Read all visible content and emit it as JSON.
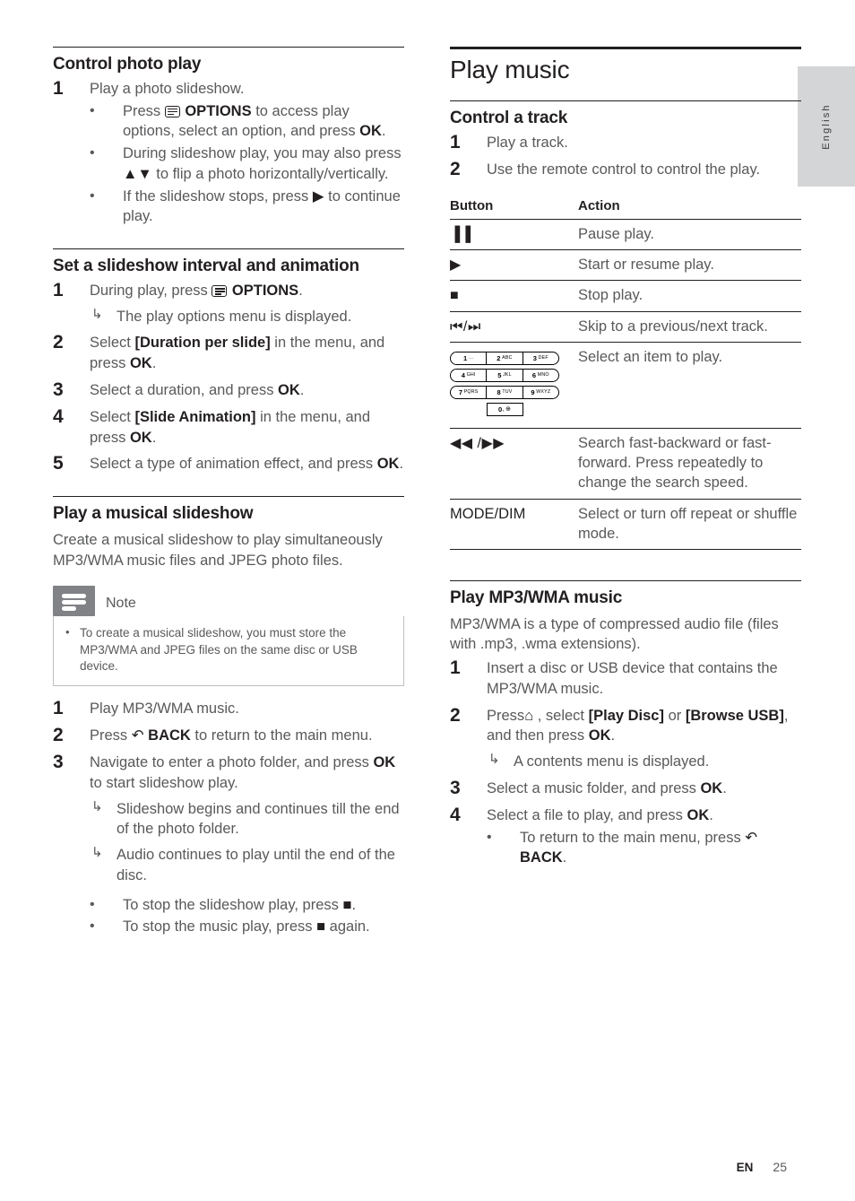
{
  "language_tab": {
    "label": "English"
  },
  "footer": {
    "locale": "EN",
    "page_number": "25"
  },
  "left_column": {
    "sections": [
      {
        "heading": "Control photo play",
        "steps": [
          {
            "num": "1",
            "text": "Play a photo slideshow.",
            "bullets": [
              {
                "pre": "Press ",
                "icon": "options-icon",
                "bold1": " OPTIONS",
                "mid": " to access play options, select an option, and press ",
                "bold2": "OK",
                "post": "."
              },
              {
                "pre": "During slideshow play, you may also press ",
                "glyph": "▲▼",
                "mid": " to flip a photo horizontally/vertically.",
                "bold2": "",
                "post": ""
              },
              {
                "pre": "If the slideshow stops, press ",
                "glyph": "▶",
                "mid": " to continue play.",
                "bold2": "",
                "post": ""
              }
            ]
          }
        ]
      },
      {
        "heading": "Set a slideshow interval and animation",
        "steps": [
          {
            "num": "1",
            "pre": "During play, press ",
            "icon": "options-icon",
            "bold1": " OPTIONS",
            "post": ".",
            "arrows": [
              "The play options menu is displayed."
            ]
          },
          {
            "num": "2",
            "pre": "Select ",
            "bold1": "[Duration per slide]",
            "mid": " in the menu, and press ",
            "bold2": "OK",
            "post": "."
          },
          {
            "num": "3",
            "pre": "Select a duration, and press ",
            "bold2": "OK",
            "post": "."
          },
          {
            "num": "4",
            "pre": "Select ",
            "bold1": "[Slide Animation]",
            "mid": " in the menu, and press ",
            "bold2": "OK",
            "post": "."
          },
          {
            "num": "5",
            "pre": "Select a type of animation effect, and press ",
            "bold2": "OK",
            "post": "."
          }
        ]
      },
      {
        "heading": "Play a musical slideshow",
        "intro": "Create a musical slideshow to play simultaneously MP3/WMA music files and JPEG photo files.",
        "note": {
          "label": "Note",
          "items": [
            "To create a musical slideshow, you must store the MP3/WMA and JPEG files on the same disc or USB device."
          ]
        },
        "steps2": [
          {
            "num": "1",
            "text": "Play MP3/WMA music."
          },
          {
            "num": "2",
            "pre": "Press ",
            "glyph": "↶",
            "bold1": " BACK",
            "post": " to return to the main menu."
          },
          {
            "num": "3",
            "pre": "Navigate to enter a photo folder, and press ",
            "bold2": "OK",
            "post": " to start slideshow play.",
            "arrows": [
              "Slideshow begins and continues till the end of the photo folder.",
              "Audio continues to play until the end of the disc."
            ],
            "bullets": [
              {
                "pre": " To stop the slideshow play, press ",
                "glyph": "■",
                "post": "."
              },
              {
                "pre": " To stop the music play, press ",
                "glyph": "■",
                "post": " again."
              }
            ]
          }
        ]
      }
    ]
  },
  "right_column": {
    "chapter_title": "Play music",
    "sections": [
      {
        "heading": "Control a track",
        "steps": [
          {
            "num": "1",
            "text": "Play a track."
          },
          {
            "num": "2",
            "text": "Use the remote control to control the play."
          }
        ]
      }
    ],
    "table": {
      "headers": [
        "Button",
        "Action"
      ],
      "rows": [
        {
          "button_glyph": "▐▐",
          "button_kind": "pause",
          "action": "Pause play."
        },
        {
          "button_glyph": "▶",
          "button_kind": "play",
          "action": "Start or resume play."
        },
        {
          "button_glyph": "■",
          "button_kind": "stop",
          "action": "Stop play."
        },
        {
          "button_glyph": "⏮/⏭",
          "button_kind": "skip",
          "action": "Skip to a previous/next track."
        },
        {
          "button_kind": "keypad",
          "action": "Select an item to play."
        },
        {
          "button_glyph": "◀◀ /▶▶",
          "button_kind": "search",
          "action": "Search fast-backward or fast-forward. Press repeatedly to change the search speed."
        },
        {
          "button_glyph": "MODE/DIM",
          "button_kind": "text",
          "action": "Select or turn off repeat or shuffle mode."
        }
      ],
      "keypad": {
        "rows": [
          [
            {
              "digit": "1",
              "letters": "…"
            },
            {
              "digit": "2",
              "letters": "ABC"
            },
            {
              "digit": "3",
              "letters": "DEF"
            }
          ],
          [
            {
              "digit": "4",
              "letters": "GHI"
            },
            {
              "digit": "5",
              "letters": "JKL"
            },
            {
              "digit": "6",
              "letters": "MNO"
            }
          ],
          [
            {
              "digit": "7",
              "letters": "PQRS"
            },
            {
              "digit": "8",
              "letters": "TUV"
            },
            {
              "digit": "9",
              "letters": "WXYZ"
            }
          ]
        ],
        "zero": {
          "digit": "0",
          "letters": ", ⊕"
        }
      }
    },
    "mp3_section": {
      "heading": "Play MP3/WMA music",
      "intro": "MP3/WMA is a type of compressed audio file (files with .mp3, .wma extensions).",
      "steps": [
        {
          "num": "1",
          "text": "Insert a disc or USB device that contains the MP3/WMA music."
        },
        {
          "num": "2",
          "pre": "Press",
          "glyph": "⌂",
          "mid": " , select ",
          "bold1": "[Play Disc]",
          "mid2": " or ",
          "bold2": "[Browse USB]",
          "mid3": ", and then press ",
          "bold3": "OK",
          "post": ".",
          "arrows": [
            "A contents menu is displayed."
          ]
        },
        {
          "num": "3",
          "pre": "Select a music folder, and press ",
          "bold3": "OK",
          "post": "."
        },
        {
          "num": "4",
          "pre": "Select a file to play, and press ",
          "bold3": "OK",
          "post": ".",
          "bullets": [
            {
              "pre": " To return to the main menu, press ",
              "glyph": "↶",
              "bold1": " BACK",
              "post": "."
            }
          ]
        }
      ]
    }
  }
}
